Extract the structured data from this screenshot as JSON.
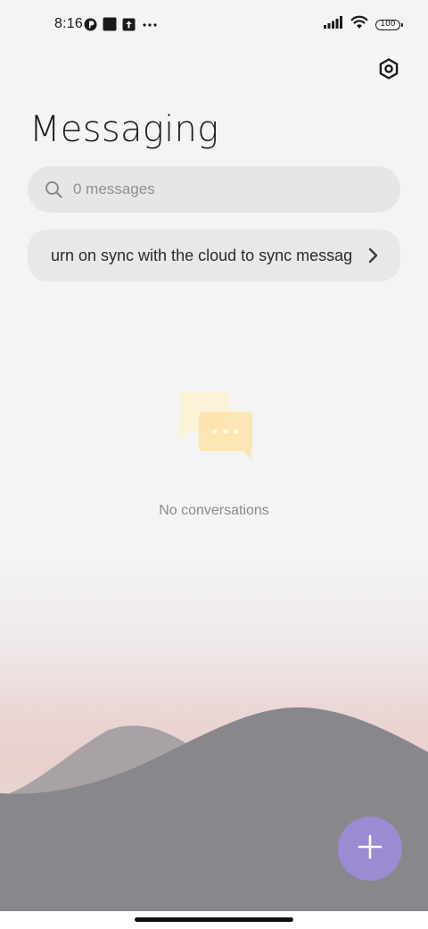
{
  "status_bar": {
    "time": "8:16",
    "battery": "100",
    "left_icons": [
      "notification-dot-icon",
      "square-app-icon",
      "upload-icon",
      "more-dots-icon"
    ],
    "right_icons": [
      "signal-icon",
      "wifi-icon",
      "battery-icon"
    ]
  },
  "header": {
    "title": "Messaging",
    "settings_icon": "settings-hexagon-icon"
  },
  "search": {
    "placeholder": "0 messages"
  },
  "sync_banner": {
    "text": "urn on sync with the cloud to sync messag"
  },
  "empty_state": {
    "text": "No conversations",
    "icon": "chat-bubbles-icon"
  },
  "fab": {
    "icon": "plus-icon"
  },
  "colors": {
    "background": "#f4f4f4",
    "search_bg": "#e6e6e6",
    "fab": "#9b8bd3",
    "mountain": "#88878c",
    "mountain_back": "#a9a2a5"
  }
}
